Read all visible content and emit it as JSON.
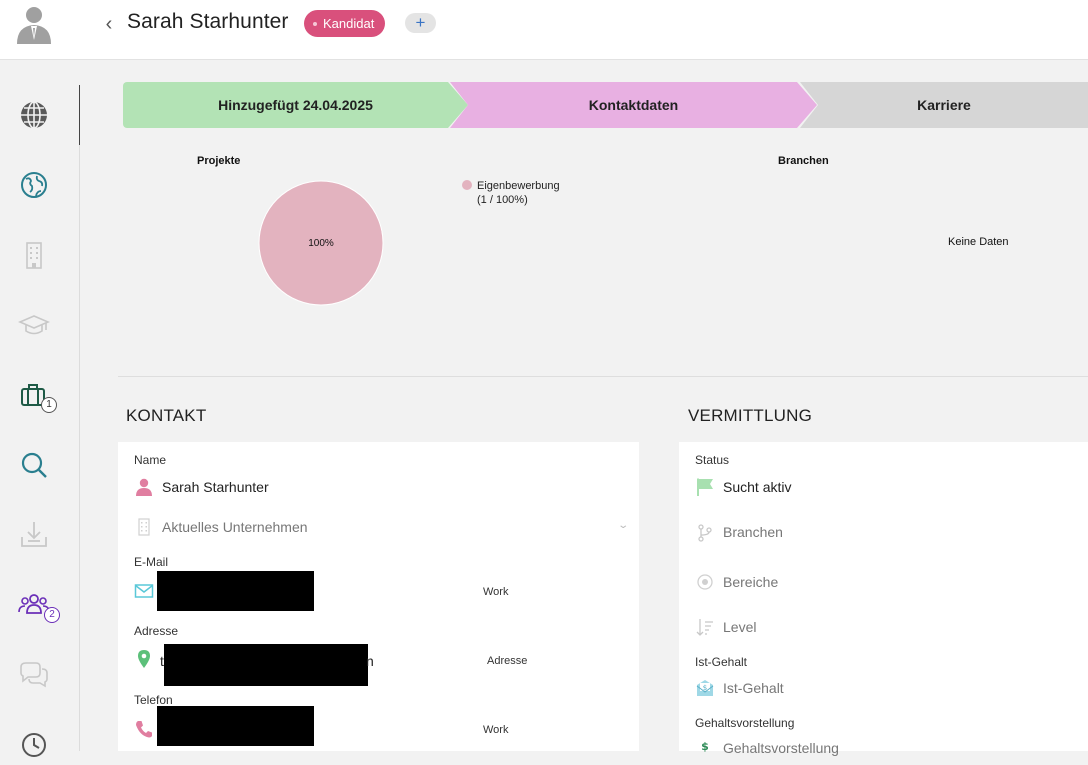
{
  "header": {
    "name": "Sarah Starhunter",
    "status_badge": "Kandidat",
    "add_label": "+"
  },
  "sidebar": {
    "items": [
      {
        "icon": "globe-icon"
      },
      {
        "icon": "earth-icon"
      },
      {
        "icon": "building-icon"
      },
      {
        "icon": "graduation-cap-icon"
      },
      {
        "icon": "briefcase-icon",
        "count": "1"
      },
      {
        "icon": "search-icon"
      },
      {
        "icon": "download-icon"
      },
      {
        "icon": "people-icon",
        "count": "2"
      },
      {
        "icon": "chat-icon"
      },
      {
        "icon": "clock-icon"
      }
    ]
  },
  "stages": [
    {
      "label": "Hinzugefügt 24.04.2025",
      "color": "#b3e3b5"
    },
    {
      "label": "Kontaktdaten",
      "color": "#e8b0e2"
    },
    {
      "label": "Karriere",
      "color": "#d6d6d6"
    }
  ],
  "chart_data": [
    {
      "type": "pie",
      "title": "Projekte",
      "slices": [
        {
          "label": "Eigenbewerbung",
          "value": 1,
          "percent": 100,
          "color": "#e3b3bf"
        }
      ],
      "slice_label": "100%",
      "legend_line1": "Eigenbewerbung",
      "legend_line2": "(1 / 100%)"
    },
    {
      "type": "pie",
      "title": "Branchen",
      "slices": [],
      "empty_text": "Keine Daten"
    }
  ],
  "kontakt": {
    "title": "KONTAKT",
    "name_label": "Name",
    "name_value": "Sarah Starhunter",
    "company_placeholder": "Aktuelles Unternehmen",
    "email_label": "E-Mail",
    "email_type": "Work",
    "address_label": "Adresse",
    "address_visible_char": "t",
    "address_visible_tail": "n",
    "address_type": "Adresse",
    "phone_label": "Telefon",
    "phone_type": "Work"
  },
  "vermittlung": {
    "title": "VERMITTLUNG",
    "status_label": "Status",
    "status_value": "Sucht aktiv",
    "branchen_placeholder": "Branchen",
    "bereiche_placeholder": "Bereiche",
    "level_placeholder": "Level",
    "ist_gehalt_label": "Ist-Gehalt",
    "ist_gehalt_placeholder": "Ist-Gehalt",
    "gehaltsvorstellung_label": "Gehaltsvorstellung",
    "gehaltsvorstellung_placeholder": "Gehaltsvorstellung"
  },
  "colors": {
    "badge": "#d9507c",
    "accent_teal": "#2a7f8f",
    "people_purple": "#6b2fb8",
    "pink_icon": "#e07ea0",
    "email_icon": "#5ac8d8",
    "location_icon": "#5cc07a",
    "flag_icon": "#a8e0b0"
  }
}
